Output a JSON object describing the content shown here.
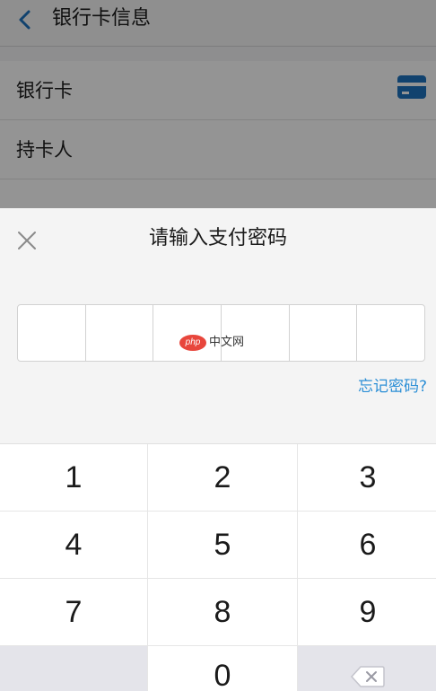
{
  "header": {
    "title": "银行卡信息",
    "back_icon": "back-chevron-icon"
  },
  "card_info": {
    "card_label": "银行卡",
    "card_icon": "credit-card-icon",
    "holder_label": "持卡人"
  },
  "password_dialog": {
    "title": "请输入支付密码",
    "close_icon": "close-icon",
    "digit_count": 6,
    "watermark_logo": "php",
    "watermark_text": "中文网",
    "forgot_link": "忘记密码?"
  },
  "keypad": {
    "keys": [
      "1",
      "2",
      "3",
      "4",
      "5",
      "6",
      "7",
      "8",
      "9",
      "",
      "0",
      "backspace"
    ],
    "backspace_icon": "backspace-icon"
  },
  "colors": {
    "accent": "#2c8fd6",
    "card_icon": "#1e73be",
    "overlay": "#000000",
    "watermark": "#e8463c"
  }
}
